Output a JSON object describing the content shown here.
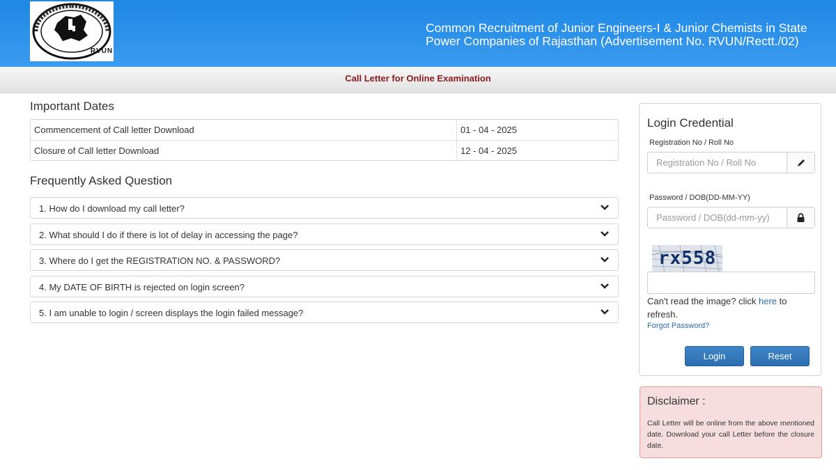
{
  "header": {
    "title": "Common Recruitment of Junior Engineers-I & Junior Chemists in State Power Companies of Rajasthan (Advertisement No. RVUN/Rectt./02)",
    "logo_text": "RVUN",
    "logo_icon": "rvun-seal-icon"
  },
  "subheader": {
    "title": "Call Letter for Online Examination"
  },
  "important_dates": {
    "title": "Important Dates",
    "rows": [
      {
        "label": "Commencement of Call letter Download",
        "value": "01 - 04 - 2025"
      },
      {
        "label": "Closure of Call letter Download",
        "value": "12 - 04 - 2025"
      }
    ]
  },
  "faq": {
    "title": "Frequently Asked Question",
    "items": [
      "1. How do I download my call letter?",
      "2. What should I do if there is lot of delay in accessing the page?",
      "3. Where do I get the REGISTRATION NO. & PASSWORD?",
      "4. My DATE OF BIRTH is rejected on login screen?",
      "5. I am unable to login / screen displays the login failed message?"
    ],
    "chevron_icon": "chevron-down-icon"
  },
  "login": {
    "title": "Login Credential",
    "reg_label": "Registration No / Roll No",
    "reg_placeholder": "Registration No / Roll No",
    "reg_icon": "pencil-icon",
    "pwd_label": "Password / DOB(DD-MM-YY)",
    "pwd_placeholder": "Password / DOB(dd-mm-yy)",
    "pwd_icon": "lock-icon",
    "captcha_text": "rx558",
    "captcha_value": "",
    "refresh_prefix": "Can't read the image? click ",
    "refresh_link": "here",
    "refresh_suffix": " to refresh.",
    "forgot": "Forgot Password?",
    "login_button": "Login",
    "reset_button": "Reset"
  },
  "disclaimer": {
    "title": "Disclaimer :",
    "text": "Call Letter will be online from the above mentioned date. Download your call Letter before the closure date."
  }
}
